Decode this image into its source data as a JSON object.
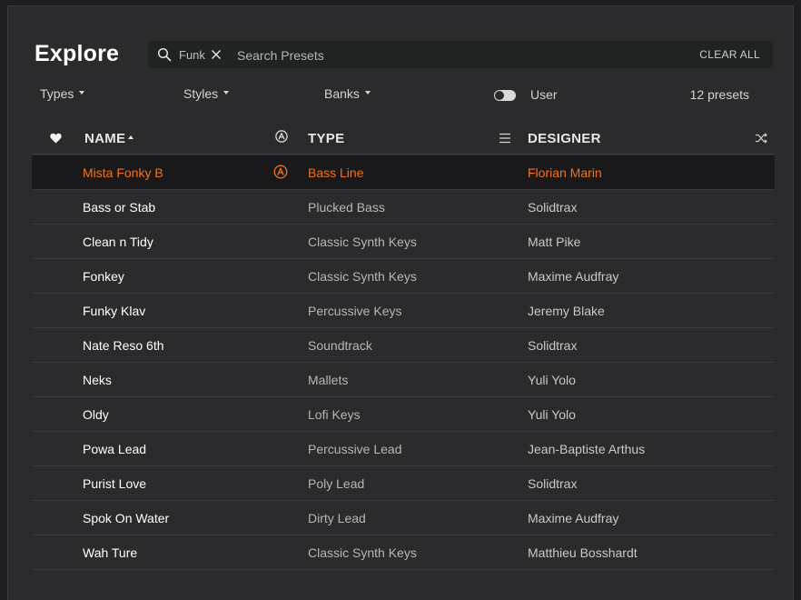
{
  "title": "Explore",
  "search": {
    "filter_chip": "Funk",
    "placeholder": "Search Presets",
    "value": "",
    "clear_label": "CLEAR ALL"
  },
  "filters": {
    "types": "Types",
    "styles": "Styles",
    "banks": "Banks",
    "user_label": "User",
    "user_toggle_on": false,
    "preset_count": "12 presets"
  },
  "columns": {
    "name": "NAME",
    "type": "TYPE",
    "designer": "DESIGNER"
  },
  "icons": {
    "favorite": "heart-icon",
    "factory": "arturia-a-icon",
    "menu": "menu-icon",
    "shuffle": "shuffle-icon",
    "search": "search-icon",
    "remove_chip": "close-icon"
  },
  "colors": {
    "accent": "#f2731c",
    "background": "#2b2b2e",
    "search_bg": "#1f2422"
  },
  "presets": [
    {
      "name": "Mista Fonky B",
      "type": "Bass Line",
      "designer": "Florian Marin",
      "selected": true
    },
    {
      "name": "Bass or Stab",
      "type": "Plucked Bass",
      "designer": "Solidtrax"
    },
    {
      "name": "Clean n Tidy",
      "type": "Classic Synth Keys",
      "designer": "Matt Pike"
    },
    {
      "name": "Fonkey",
      "type": "Classic Synth Keys",
      "designer": "Maxime Audfray"
    },
    {
      "name": "Funky Klav",
      "type": "Percussive Keys",
      "designer": "Jeremy Blake"
    },
    {
      "name": "Nate Reso 6th",
      "type": "Soundtrack",
      "designer": "Solidtrax"
    },
    {
      "name": "Neks",
      "type": "Mallets",
      "designer": "Yuli Yolo"
    },
    {
      "name": "Oldy",
      "type": "Lofi Keys",
      "designer": "Yuli Yolo"
    },
    {
      "name": "Powa Lead",
      "type": "Percussive Lead",
      "designer": "Jean-Baptiste Arthus"
    },
    {
      "name": "Purist Love",
      "type": "Poly Lead",
      "designer": "Solidtrax"
    },
    {
      "name": "Spok On Water",
      "type": "Dirty Lead",
      "designer": "Maxime Audfray"
    },
    {
      "name": "Wah Ture",
      "type": "Classic Synth Keys",
      "designer": "Matthieu Bosshardt"
    }
  ]
}
